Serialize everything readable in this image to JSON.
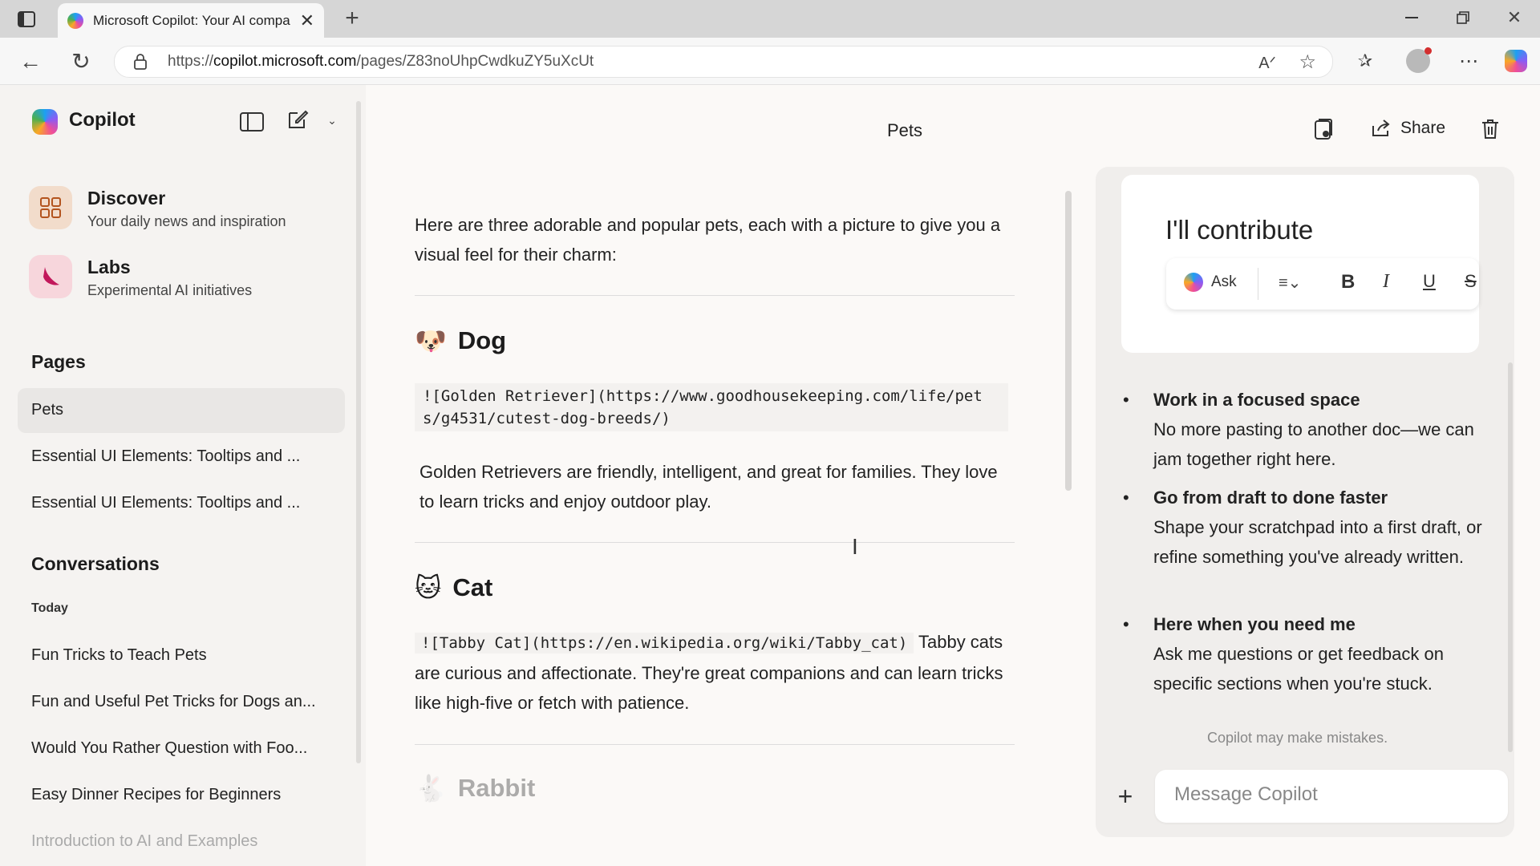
{
  "browser": {
    "tab_title": "Microsoft Copilot: Your AI compa",
    "url_prefix": "https://",
    "url_host": "copilot.microsoft.com",
    "url_path": "/pages/Z83noUhpCwdkuZY5uXcUt"
  },
  "sidebar": {
    "app_name": "Copilot",
    "nav": [
      {
        "title": "Discover",
        "subtitle": "Your daily news and inspiration"
      },
      {
        "title": "Labs",
        "subtitle": "Experimental AI initiatives"
      }
    ],
    "pages_heading": "Pages",
    "pages": [
      "Pets",
      "Essential UI Elements: Tooltips and ...",
      "Essential UI Elements: Tooltips and ..."
    ],
    "conversations_heading": "Conversations",
    "today_label": "Today",
    "conversations": [
      "Fun Tricks to Teach Pets",
      "Fun and Useful Pet Tricks for Dogs an...",
      "Would You Rather Question with Foo...",
      "Easy Dinner Recipes for Beginners",
      "Introduction to AI and Examples"
    ]
  },
  "main": {
    "page_title": "Pets",
    "share_label": "Share",
    "intro": "Here are three adorable and popular pets, each with a picture to give you a visual feel for their charm:",
    "pets": [
      {
        "emoji": "🐶",
        "name": "Dog",
        "code": "![Golden Retriever](https://www.goodhousekeeping.com/life/pets/g4531/cutest-dog-breeds/)",
        "text": "Golden Retrievers are friendly, intelligent, and great for families. They love to learn tricks and enjoy outdoor play."
      },
      {
        "emoji": "🐱",
        "name": "Cat",
        "code": "![Tabby Cat](https://en.wikipedia.org/wiki/Tabby_cat)",
        "text": "Tabby cats are curious and affectionate. They're great companions and can learn tricks like high-five or fetch with patience."
      },
      {
        "emoji": "🐇",
        "name": "Rabbit"
      }
    ]
  },
  "panel": {
    "card_title": "I'll contribute",
    "ask_label": "Ask",
    "features": [
      {
        "title": "Work in a focused space",
        "desc": "No more pasting to another doc—we can jam together right here."
      },
      {
        "title": "Go from draft to done faster",
        "desc": "Shape your scratchpad into a first draft, or refine something you've already written."
      },
      {
        "title": "Here when you need me",
        "desc": "Ask me questions or get feedback on specific sections when you're stuck."
      }
    ],
    "disclaimer": "Copilot may make mistakes.",
    "message_placeholder": "Message Copilot"
  }
}
